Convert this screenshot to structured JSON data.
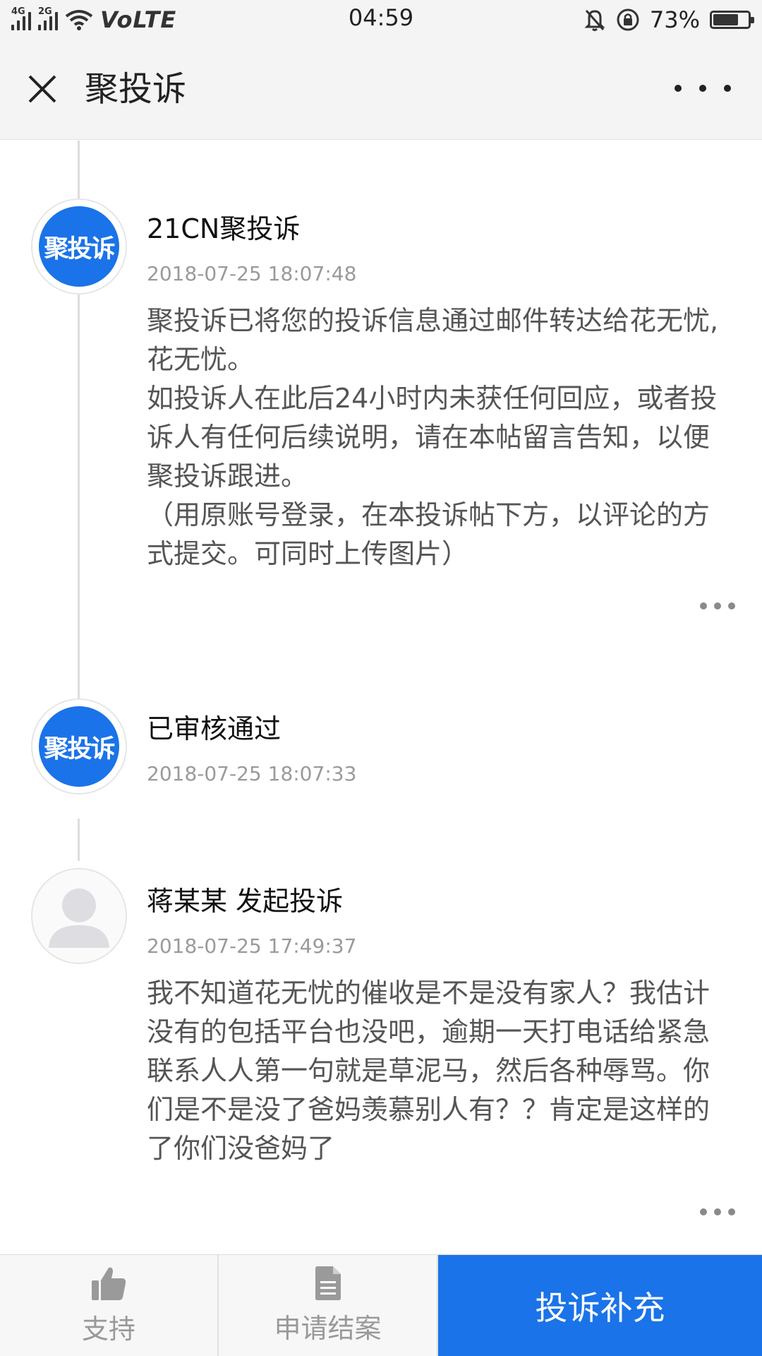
{
  "status_bar": {
    "network1": "4G",
    "network2": "2G",
    "volte": "VoLTE",
    "time": "04:59",
    "battery_percent": "73%",
    "battery_level": 0.73
  },
  "header": {
    "title": "聚投诉"
  },
  "timeline": [
    {
      "avatar_text": "聚投诉",
      "name": "21CN聚投诉",
      "time": "2018-07-25 18:07:48",
      "body": [
        "聚投诉已将您的投诉信息通过邮件转达给花无忧,花无忧。",
        "如投诉人在此后24小时内未获任何回应，或者投诉人有任何后续说明，请在本帖留言告知，以便聚投诉跟进。",
        "（用原账号登录，在本投诉帖下方，以评论的方式提交。可同时上传图片）"
      ]
    },
    {
      "avatar_text": "聚投诉",
      "name": "已审核通过",
      "time": "2018-07-25 18:07:33"
    },
    {
      "name": "蒋某某 发起投诉",
      "time": "2018-07-25 17:49:37",
      "body": [
        "我不知道花无忧的催收是不是没有家人？我估计没有的包括平台也没吧，逾期一天打电话给紧急联系人人第一句就是草泥马，然后各种辱骂。你们是不是没了爸妈羡慕别人有？？肯定是这样的了你们没爸妈了"
      ]
    }
  ],
  "bottom_bar": {
    "support_label": "支持",
    "close_case_label": "申请结案",
    "supplement_label": "投诉补充"
  },
  "colors": {
    "accent": "#1a73e8",
    "bar_bg": "#f4f4f4",
    "muted_text": "#9a9a9a"
  }
}
